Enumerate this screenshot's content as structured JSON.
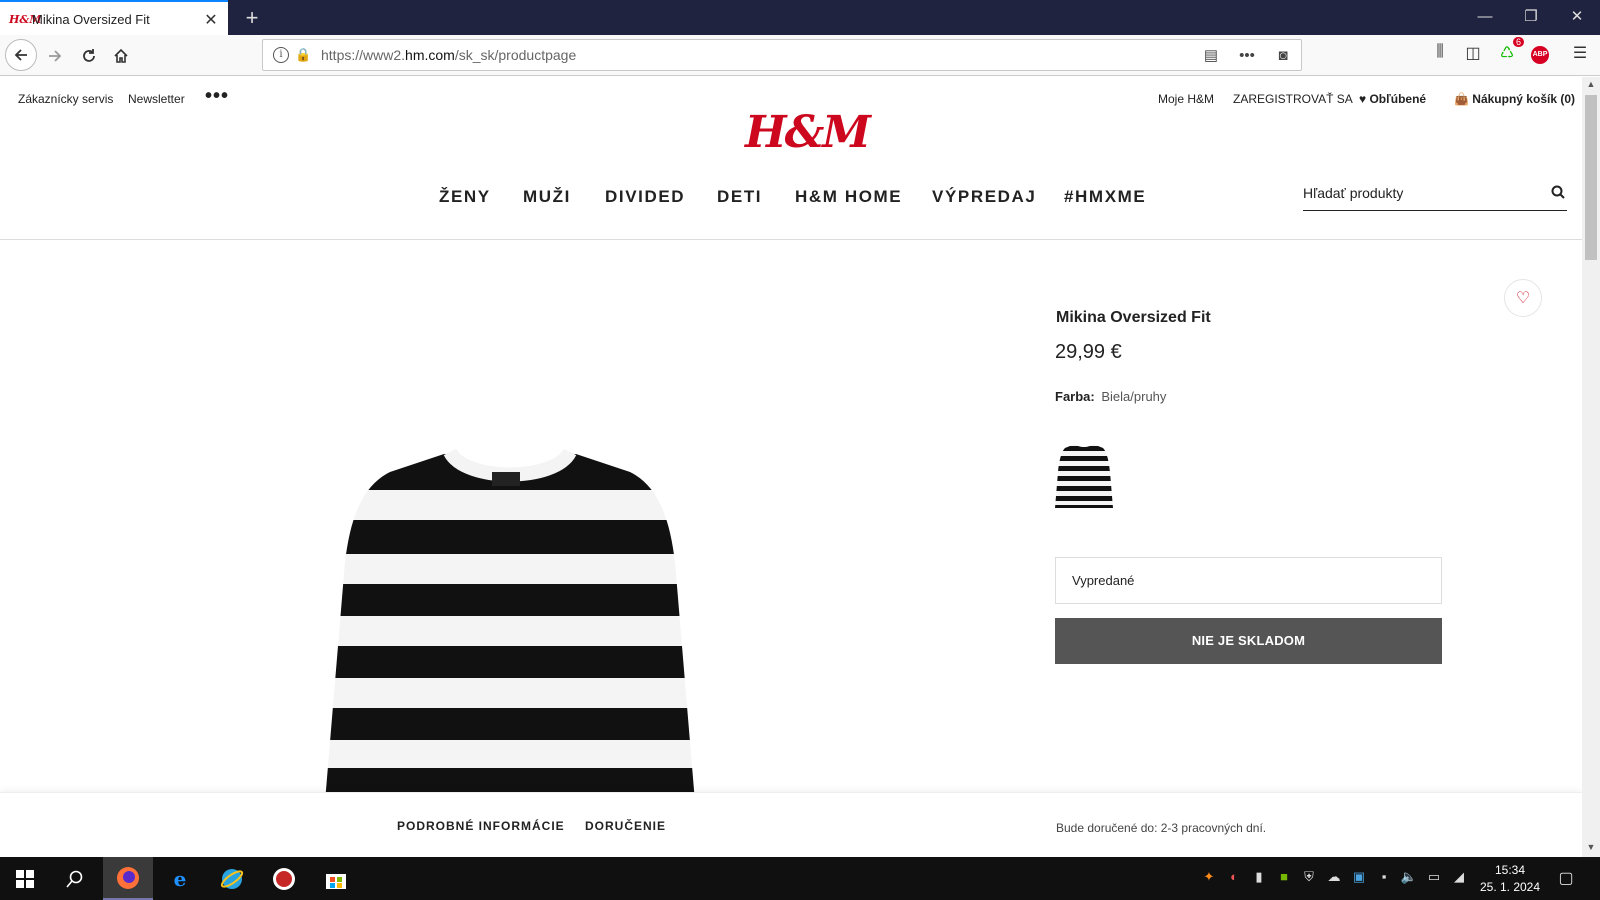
{
  "browser": {
    "tab_title": "Mikina Oversized Fit",
    "tab_favicon": "H&M",
    "new_tab": "+",
    "url_prefix": "https://www2.",
    "url_domain": "hm.com",
    "url_path": "/sk_sk/productpage",
    "addon_badge": "6",
    "abp_label": "ABP"
  },
  "header": {
    "customer_service": "Zákaznícky servis",
    "newsletter": "Newsletter",
    "more": "•••",
    "my_account": "Moje H&M",
    "register": "ZAREGISTROVAŤ SA",
    "favorites": "Obľúbené",
    "cart": "Nákupný košík (0)",
    "logo": "H&M"
  },
  "nav": {
    "items": [
      "ŽENY",
      "MUŽI",
      "DIVIDED",
      "DETI",
      "H&M HOME",
      "VÝPREDAJ",
      "#HMXME"
    ]
  },
  "search": {
    "placeholder": "Hľadať produkty"
  },
  "product": {
    "name": "Mikina Oversized Fit",
    "price": "29,99 €",
    "color_label": "Farba:",
    "color_value": "Biela/pruhy",
    "size_select": "Vypredané",
    "status_button": "NIE JE SKLADOM"
  },
  "bottom": {
    "details_tab": "PODROBNÉ INFORMÁCIE",
    "delivery_tab": "DORUČENIE",
    "delivery_info": "Bude doručené do: 2-3 pracovných dní."
  },
  "taskbar": {
    "time": "15:34",
    "date": "25. 1. 2024"
  },
  "colors": {
    "brand_red": "#cc071e",
    "titlebar": "#202340",
    "button_gray": "#555555"
  }
}
